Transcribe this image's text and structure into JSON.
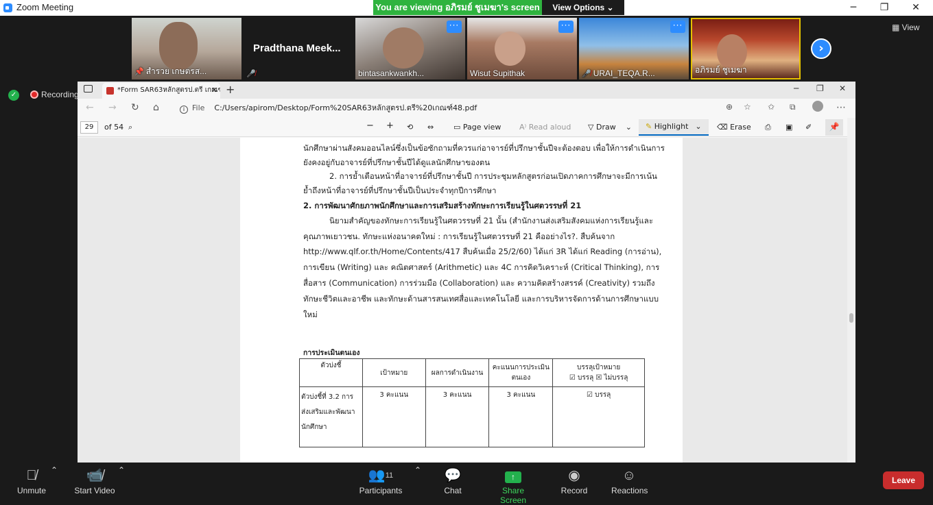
{
  "window": {
    "title": "Zoom Meeting",
    "min": "─",
    "max": "❐",
    "close": "✕"
  },
  "banner": {
    "viewing": "You are viewing อภิรมย์ ชูเมฆา's screen",
    "view_options": "View Options ⌄"
  },
  "participants_strip": [
    {
      "name": "สำรวย เกษตรส...",
      "muted": true,
      "more": false
    },
    {
      "name": "Pradthana  Meek...",
      "muted": true,
      "more": false
    },
    {
      "name": "bintasankwankh...",
      "muted": false,
      "more": true
    },
    {
      "name": "Wisut Supithak",
      "muted": false,
      "more": true
    },
    {
      "name": "URAI_TEQA.R...",
      "muted": true,
      "more": true
    },
    {
      "name": "อภิรมย์ ชูเมฆา",
      "muted": false,
      "more": false
    }
  ],
  "view_btn": "View",
  "recording_label": "Recording",
  "browser": {
    "tab_title": "*Form SAR63หลักสูตรป.ตรี เกณฑ์4...",
    "new_tab": "+",
    "file_label": "File",
    "url": "C:/Users/apirom/Desktop/Form%20SAR63หลักสูตรป.ตรี%20เกณฑ์48.pdf",
    "page_number": "29",
    "page_total": "of 54",
    "toolbar": {
      "page_view": "Page view",
      "read_aloud": "Read aloud",
      "draw": "Draw",
      "highlight": "Highlight",
      "erase": "Erase"
    }
  },
  "document": {
    "lines": [
      "นักศึกษาผ่านสังคมออนไลน์ซึ่งเป็นข้อซักถามที่ควรแก่อาจารย์ที่ปรึกษาชั้นปีจะต้องตอบ เพื่อให้การดำเนินการ",
      "ยังคงอยู่กับอาจารย์ที่ปรึกษาชั้นปีได้ดูแลนักศึกษาของตน",
      "2. การย้ำเตือนหน้าที่อาจารย์ที่ปรึกษาชั้นปี การประชุมหลักสูตรก่อนเปิดภาคการศึกษาจะมีการเน้น",
      "ย้ำถึงหน้าที่อาจารย์ที่ปรึกษาชั้นปีเป็นประจำทุกปีการศึกษา",
      "2. การพัฒนาศักยภาพนักศึกษาและการเสริมสร้างทักษะการเรียนรู้ในศตวรรษที่ 21",
      "นิยามสำคัญของทักษะการเรียนรู้ในศตวรรษที่ 21 นั้น (สำนักงานส่งเสริมสังคมแห่งการเรียนรู้และ",
      "คุณภาพเยาวชน. ทักษะแห่งอนาคตใหม่ : การเรียนรู้ในศตวรรษที่ 21 คืออย่างไร?. สืบค้นจาก",
      "http://www.qlf.or.th/Home/Contents/417 สืบค้นเมื่อ 25/2/60) ได้แก่ 3R ได้แก่ Reading (การอ่าน),",
      "การเขียน (Writing) และ คณิตศาสตร์ (Arithmetic) และ 4C การคิดวิเคราะห์ (Critical Thinking), การ",
      "สื่อสาร (Communication) การร่วมมือ (Collaboration) และ ความคิดสร้างสรรค์ (Creativity) รวมถึง",
      "ทักษะชีวิตและอาชีพ และทักษะด้านสารสนเทศสื่อและเทคโนโลยี และการบริหารจัดการด้านการศึกษาแบบ",
      "ใหม่"
    ],
    "eval_heading": "การประเมินตนเอง",
    "table": {
      "headers": [
        "ตัวบ่งชี้",
        "เป้าหมาย",
        "ผลการดำเนินงาน",
        "คะแนนการประเมิน ตนเอง",
        "บรรลุเป้าหมาย"
      ],
      "header_sub": "☑ บรรลุ ☒ ไม่บรรลุ",
      "row": [
        "ตัวบ่งชี้ที่ 3.2 การส่งเสริมและพัฒนานักศึกษา",
        "3 คะแนน",
        "3 คะแนน",
        "3 คะแนน",
        "☑ บรรลุ"
      ]
    }
  },
  "controls": {
    "unmute": "Unmute",
    "start_video": "Start Video",
    "participants": "Participants",
    "participants_count": "11",
    "chat": "Chat",
    "share_screen": "Share Screen",
    "record": "Record",
    "reactions": "Reactions",
    "leave": "Leave"
  },
  "colors": {
    "zoom_blue": "#2d8cff",
    "green": "#2fb33f",
    "leave_red": "#c82d2d"
  }
}
